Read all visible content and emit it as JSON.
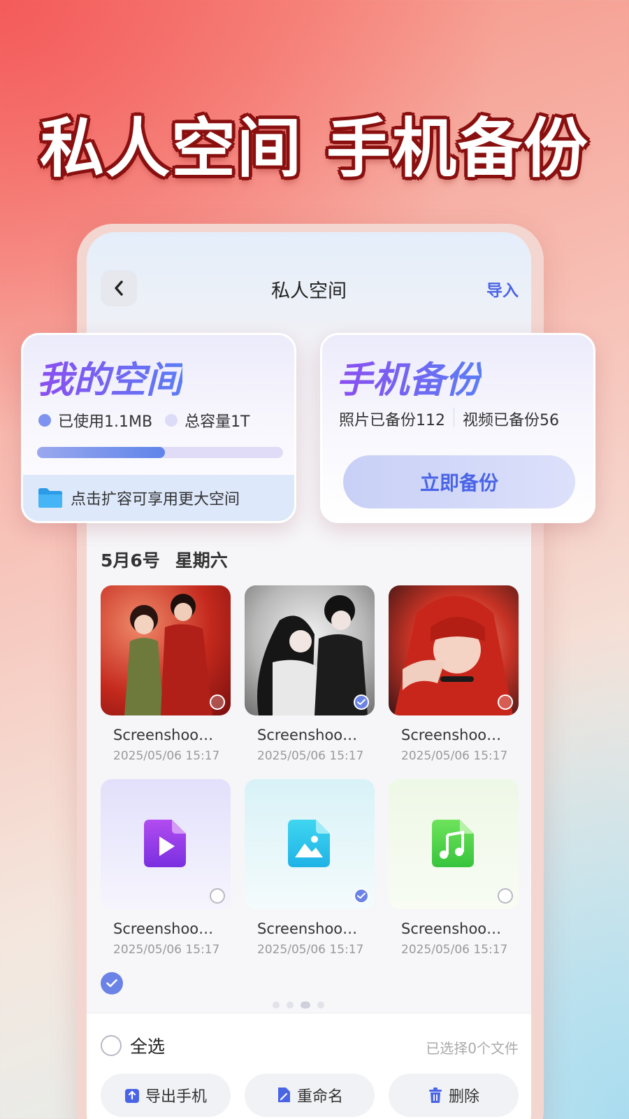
{
  "headline": "私人空间 手机备份",
  "header": {
    "title": "私人空间",
    "import_label": "导入"
  },
  "space_card": {
    "title": "我的空间",
    "used_label": "已使用1.1MB",
    "total_label": "总容量1T",
    "usage_fraction": 0.52,
    "expand_label": "点击扩容可享用更大空间",
    "colors": {
      "used": "#7d93ef",
      "total": "#dcdcf8",
      "expand_bg": "#dde8fb"
    }
  },
  "backup_card": {
    "title": "手机备份",
    "photos_label": "照片已备份112",
    "videos_label": "视频已备份56",
    "button_label": "立即备份"
  },
  "section": {
    "date": "5月6号",
    "weekday": "星期六"
  },
  "files": [
    {
      "name": "Screenshoo…",
      "date": "2025/05/06 15:17",
      "kind": "photo",
      "selected": false
    },
    {
      "name": "Screenshoo…",
      "date": "2025/05/06 15:17",
      "kind": "photo",
      "selected": true
    },
    {
      "name": "Screenshoo…",
      "date": "2025/05/06 15:17",
      "kind": "photo",
      "selected": false
    },
    {
      "name": "Screenshoo…",
      "date": "2025/05/06 15:17",
      "kind": "video",
      "icon": "video-file-icon",
      "selected": false
    },
    {
      "name": "Screenshoo…",
      "date": "2025/05/06 15:17",
      "kind": "image",
      "icon": "image-file-icon",
      "selected": true
    },
    {
      "name": "Screenshoo…",
      "date": "2025/05/06 15:17",
      "kind": "music",
      "icon": "music-file-icon",
      "selected": false
    }
  ],
  "footer": {
    "select_all_label": "全选",
    "selected_count_label": "已选择0个文件",
    "actions": [
      {
        "label": "导出手机",
        "icon": "export-icon"
      },
      {
        "label": "重命名",
        "icon": "rename-icon"
      },
      {
        "label": "删除",
        "icon": "trash-icon"
      }
    ]
  },
  "accent_color": "#4a64e6"
}
